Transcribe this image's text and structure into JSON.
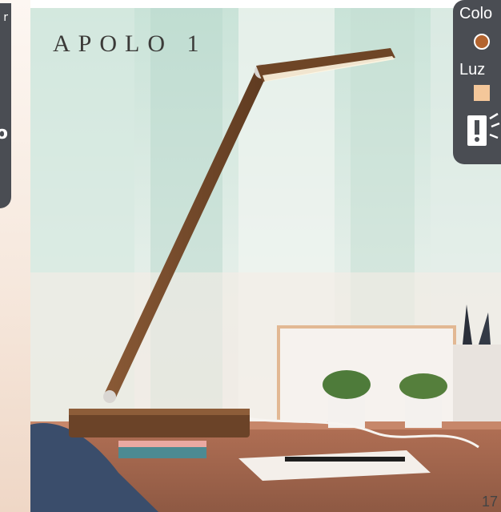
{
  "brand": {
    "name": "APOLO",
    "number": "1"
  },
  "left_panel": {
    "glyph_top": "r",
    "glyph_mid": "o"
  },
  "options_panel": {
    "color_label": "Colo",
    "color_swatch": "#b3642f",
    "light_label": "Luz",
    "light_swatch": "#f4c79a",
    "mode_icon": "light-switch-icon"
  },
  "page": {
    "number": "17"
  },
  "colors": {
    "lamp": "#7a4c2b",
    "panel": "#4a4d53",
    "table": "#a86a4c"
  }
}
